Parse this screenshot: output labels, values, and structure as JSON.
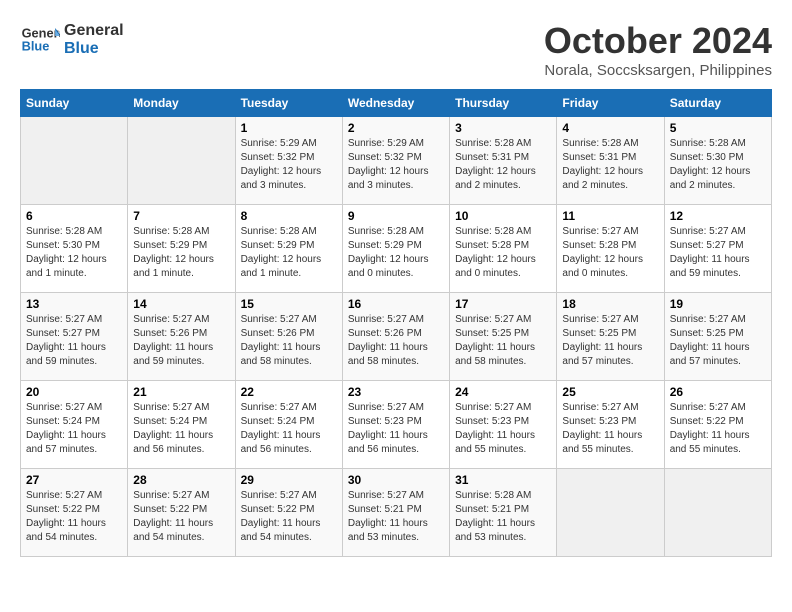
{
  "logo": {
    "line1": "General",
    "line2": "Blue"
  },
  "title": "October 2024",
  "location": "Norala, Soccsksargen, Philippines",
  "weekdays": [
    "Sunday",
    "Monday",
    "Tuesday",
    "Wednesday",
    "Thursday",
    "Friday",
    "Saturday"
  ],
  "weeks": [
    [
      {
        "day": "",
        "info": ""
      },
      {
        "day": "",
        "info": ""
      },
      {
        "day": "1",
        "info": "Sunrise: 5:29 AM\nSunset: 5:32 PM\nDaylight: 12 hours and 3 minutes."
      },
      {
        "day": "2",
        "info": "Sunrise: 5:29 AM\nSunset: 5:32 PM\nDaylight: 12 hours and 3 minutes."
      },
      {
        "day": "3",
        "info": "Sunrise: 5:28 AM\nSunset: 5:31 PM\nDaylight: 12 hours and 2 minutes."
      },
      {
        "day": "4",
        "info": "Sunrise: 5:28 AM\nSunset: 5:31 PM\nDaylight: 12 hours and 2 minutes."
      },
      {
        "day": "5",
        "info": "Sunrise: 5:28 AM\nSunset: 5:30 PM\nDaylight: 12 hours and 2 minutes."
      }
    ],
    [
      {
        "day": "6",
        "info": "Sunrise: 5:28 AM\nSunset: 5:30 PM\nDaylight: 12 hours and 1 minute."
      },
      {
        "day": "7",
        "info": "Sunrise: 5:28 AM\nSunset: 5:29 PM\nDaylight: 12 hours and 1 minute."
      },
      {
        "day": "8",
        "info": "Sunrise: 5:28 AM\nSunset: 5:29 PM\nDaylight: 12 hours and 1 minute."
      },
      {
        "day": "9",
        "info": "Sunrise: 5:28 AM\nSunset: 5:29 PM\nDaylight: 12 hours and 0 minutes."
      },
      {
        "day": "10",
        "info": "Sunrise: 5:28 AM\nSunset: 5:28 PM\nDaylight: 12 hours and 0 minutes."
      },
      {
        "day": "11",
        "info": "Sunrise: 5:27 AM\nSunset: 5:28 PM\nDaylight: 12 hours and 0 minutes."
      },
      {
        "day": "12",
        "info": "Sunrise: 5:27 AM\nSunset: 5:27 PM\nDaylight: 11 hours and 59 minutes."
      }
    ],
    [
      {
        "day": "13",
        "info": "Sunrise: 5:27 AM\nSunset: 5:27 PM\nDaylight: 11 hours and 59 minutes."
      },
      {
        "day": "14",
        "info": "Sunrise: 5:27 AM\nSunset: 5:26 PM\nDaylight: 11 hours and 59 minutes."
      },
      {
        "day": "15",
        "info": "Sunrise: 5:27 AM\nSunset: 5:26 PM\nDaylight: 11 hours and 58 minutes."
      },
      {
        "day": "16",
        "info": "Sunrise: 5:27 AM\nSunset: 5:26 PM\nDaylight: 11 hours and 58 minutes."
      },
      {
        "day": "17",
        "info": "Sunrise: 5:27 AM\nSunset: 5:25 PM\nDaylight: 11 hours and 58 minutes."
      },
      {
        "day": "18",
        "info": "Sunrise: 5:27 AM\nSunset: 5:25 PM\nDaylight: 11 hours and 57 minutes."
      },
      {
        "day": "19",
        "info": "Sunrise: 5:27 AM\nSunset: 5:25 PM\nDaylight: 11 hours and 57 minutes."
      }
    ],
    [
      {
        "day": "20",
        "info": "Sunrise: 5:27 AM\nSunset: 5:24 PM\nDaylight: 11 hours and 57 minutes."
      },
      {
        "day": "21",
        "info": "Sunrise: 5:27 AM\nSunset: 5:24 PM\nDaylight: 11 hours and 56 minutes."
      },
      {
        "day": "22",
        "info": "Sunrise: 5:27 AM\nSunset: 5:24 PM\nDaylight: 11 hours and 56 minutes."
      },
      {
        "day": "23",
        "info": "Sunrise: 5:27 AM\nSunset: 5:23 PM\nDaylight: 11 hours and 56 minutes."
      },
      {
        "day": "24",
        "info": "Sunrise: 5:27 AM\nSunset: 5:23 PM\nDaylight: 11 hours and 55 minutes."
      },
      {
        "day": "25",
        "info": "Sunrise: 5:27 AM\nSunset: 5:23 PM\nDaylight: 11 hours and 55 minutes."
      },
      {
        "day": "26",
        "info": "Sunrise: 5:27 AM\nSunset: 5:22 PM\nDaylight: 11 hours and 55 minutes."
      }
    ],
    [
      {
        "day": "27",
        "info": "Sunrise: 5:27 AM\nSunset: 5:22 PM\nDaylight: 11 hours and 54 minutes."
      },
      {
        "day": "28",
        "info": "Sunrise: 5:27 AM\nSunset: 5:22 PM\nDaylight: 11 hours and 54 minutes."
      },
      {
        "day": "29",
        "info": "Sunrise: 5:27 AM\nSunset: 5:22 PM\nDaylight: 11 hours and 54 minutes."
      },
      {
        "day": "30",
        "info": "Sunrise: 5:27 AM\nSunset: 5:21 PM\nDaylight: 11 hours and 53 minutes."
      },
      {
        "day": "31",
        "info": "Sunrise: 5:28 AM\nSunset: 5:21 PM\nDaylight: 11 hours and 53 minutes."
      },
      {
        "day": "",
        "info": ""
      },
      {
        "day": "",
        "info": ""
      }
    ]
  ]
}
